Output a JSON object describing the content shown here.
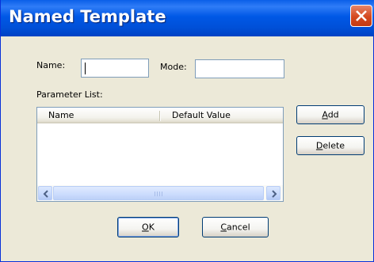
{
  "window": {
    "title": "Named Template"
  },
  "form": {
    "name_label": "Name:",
    "name_value": "",
    "mode_label": "Mode:",
    "mode_value": "",
    "parameter_list_label": "Parameter List:"
  },
  "parameter_list": {
    "columns": [
      "Name",
      "Default Value"
    ],
    "rows": []
  },
  "buttons": {
    "add": {
      "mnemonic": "A",
      "rest": "dd"
    },
    "delete": {
      "mnemonic": "D",
      "rest": "elete"
    },
    "ok": {
      "mnemonic": "O",
      "rest": "K"
    },
    "cancel": {
      "mnemonic": "C",
      "rest": "ancel"
    }
  },
  "icons": {
    "close": "close-icon",
    "scroll_left": "chevron-left-icon",
    "scroll_right": "chevron-right-icon"
  },
  "colors": {
    "titlebar": "#0058e6",
    "close_button": "#d4491f",
    "dialog_background": "#ece9d8"
  }
}
